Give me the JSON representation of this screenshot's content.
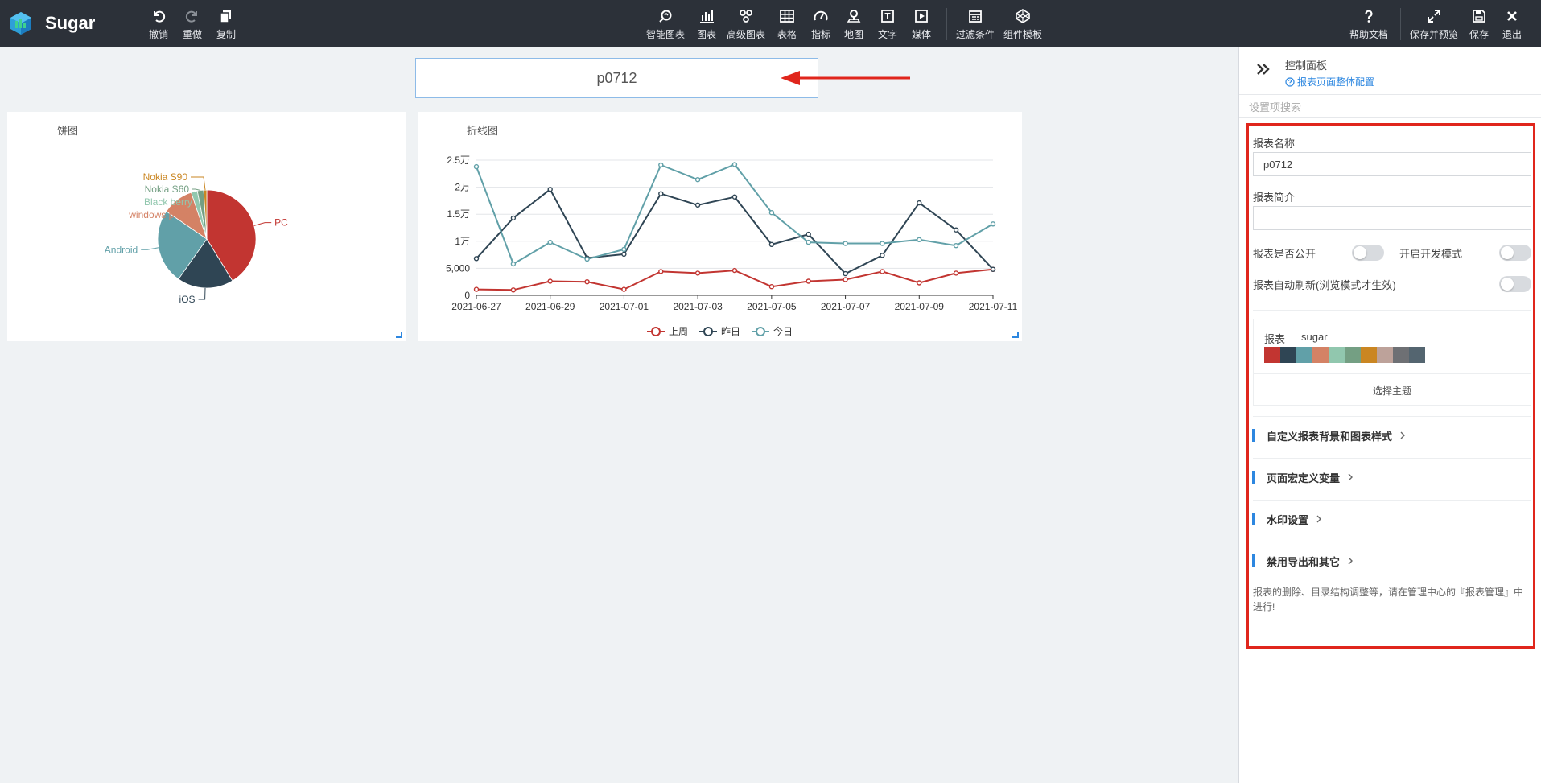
{
  "brand": {
    "name": "Sugar"
  },
  "toolbar": {
    "undo": "撤销",
    "redo": "重做",
    "copy": "复制",
    "smart_chart": "智能图表",
    "chart": "图表",
    "advanced_chart": "高级图表",
    "table": "表格",
    "indicator": "指标",
    "map": "地图",
    "text": "文字",
    "media": "媒体",
    "filter": "过滤条件",
    "component_template": "组件模板",
    "help": "帮助文档",
    "save_preview": "保存并预览",
    "save": "保存",
    "exit": "退出"
  },
  "canvas": {
    "report_title": "p0712",
    "pie_panel_title": "饼图",
    "line_panel_title": "折线图"
  },
  "chart_data": [
    {
      "type": "pie",
      "title": "饼图",
      "slices": [
        {
          "label": "PC",
          "value": 40,
          "color": "#c23531"
        },
        {
          "label": "iOS",
          "value": 18,
          "color": "#2f4554"
        },
        {
          "label": "Android",
          "value": 24,
          "color": "#61a0a8"
        },
        {
          "label": "windows phone",
          "value": 10,
          "color": "#d48265"
        },
        {
          "label": "Black berry",
          "value": 2,
          "color": "#91c7ae"
        },
        {
          "label": "Nokia S60",
          "value": 2,
          "color": "#749f83"
        },
        {
          "label": "Nokia S90",
          "value": 1,
          "color": "#ca8622"
        }
      ]
    },
    {
      "type": "line",
      "title": "折线图",
      "x": [
        "2021-06-27",
        "2021-06-28",
        "2021-06-29",
        "2021-06-30",
        "2021-07-01",
        "2021-07-02",
        "2021-07-03",
        "2021-07-04",
        "2021-07-05",
        "2021-07-06",
        "2021-07-07",
        "2021-07-08",
        "2021-07-09",
        "2021-07-10",
        "2021-07-11"
      ],
      "x_ticks": [
        "2021-06-27",
        "2021-06-29",
        "2021-07-01",
        "2021-07-03",
        "2021-07-05",
        "2021-07-07",
        "2021-07-09",
        "2021-07-11"
      ],
      "ylim": [
        0,
        25000
      ],
      "y_ticks": [
        0,
        5000,
        10000,
        15000,
        20000,
        25000
      ],
      "y_tick_labels": [
        "0",
        "5,000",
        "1万",
        "1.5万",
        "2万",
        "2.5万"
      ],
      "grid": true,
      "legend_position": "bottom",
      "series": [
        {
          "name": "上周",
          "color": "#c23531",
          "values": [
            1100,
            1000,
            2600,
            2500,
            1100,
            4400,
            4100,
            4600,
            1600,
            2600,
            2900,
            4400,
            2300,
            4100,
            4800
          ]
        },
        {
          "name": "昨日",
          "color": "#2f4554",
          "values": [
            6800,
            14300,
            19600,
            6900,
            7600,
            18800,
            16700,
            18200,
            9400,
            11300,
            4000,
            7400,
            17100,
            12100,
            4800
          ]
        },
        {
          "name": "今日",
          "color": "#61a0a8",
          "values": [
            23800,
            5800,
            9800,
            6700,
            8500,
            24100,
            21400,
            24200,
            15300,
            9800,
            9600,
            9600,
            10300,
            9200,
            13200
          ]
        }
      ]
    }
  ],
  "panel": {
    "title": "控制面板",
    "config_link": "报表页面整体配置",
    "search_placeholder": "设置项搜索",
    "report_name_label": "报表名称",
    "report_name_value": "p0712",
    "report_intro_label": "报表简介",
    "report_intro_value": "",
    "public_label": "报表是否公开",
    "dev_mode_label": "开启开发模式",
    "auto_refresh_label": "报表自动刷新(浏览模式才生效)",
    "theme_label": "报表",
    "theme_name": "sugar",
    "theme_colors": [
      "#c23531",
      "#2f4554",
      "#61a0a8",
      "#d48265",
      "#91c7ae",
      "#749f83",
      "#ca8622",
      "#bda29a",
      "#6e7074",
      "#546570"
    ],
    "choose_theme": "选择主题",
    "sections": [
      "自定义报表背景和图表样式",
      "页面宏定义变量",
      "水印设置",
      "禁用导出和其它"
    ],
    "footer_note": "报表的删除、目录结构调整等，请在管理中心的『报表管理』中进行!"
  }
}
